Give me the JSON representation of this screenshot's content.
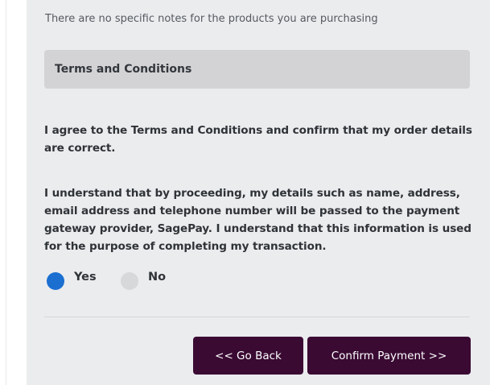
{
  "notes_text": "There are no specific notes for the products you are purchasing",
  "terms": {
    "heading": "Terms and Conditions",
    "agree_text": "I agree to the Terms and Conditions and confirm that my order details are correct.",
    "consent_text": "I understand that by proceeding, my details such as name, address, email address and telephone number will be passed to the payment gateway provider, SagePay. I understand that this information is used for the purpose of completing my transaction."
  },
  "consent_options": {
    "selected": "Yes",
    "yes_label": "Yes",
    "no_label": "No"
  },
  "actions": {
    "back_label": "<< Go Back",
    "confirm_label": "Confirm Payment >>"
  },
  "colors": {
    "panel_background": "#ebecee",
    "header_background": "#d3d3d5",
    "radio_selected": "#1a6fd1",
    "radio_unselected": "#d7d8da",
    "button_background": "#3a0a33",
    "button_text": "#ffffff"
  }
}
